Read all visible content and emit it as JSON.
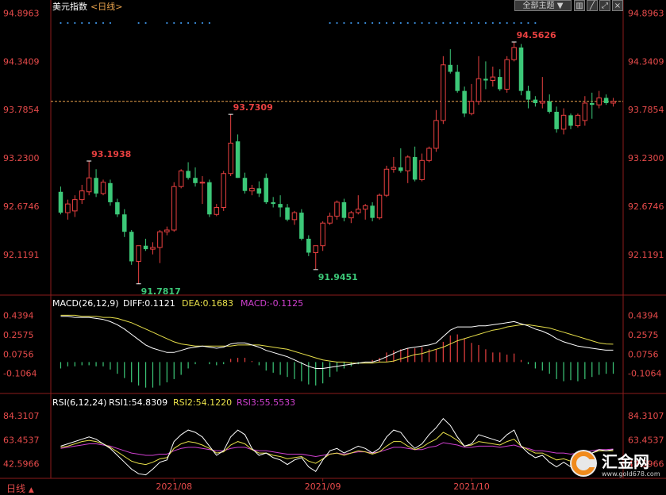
{
  "header": {
    "title": "美元指数",
    "period_link": "<日线>",
    "theme_selector": "全部主题",
    "theme_arrow": "▼"
  },
  "footer": {
    "period_label": "日线",
    "period_arrow": "▲"
  },
  "watermark": {
    "name": "汇金网",
    "url": "www.gold678.com"
  },
  "colors": {
    "background": "#000000",
    "up": "#e84040",
    "down": "#3cc878",
    "axis_text": "#e84b4b",
    "grid": "#8b1c1c",
    "price_line": "#e8a24c",
    "diff_line": "#ffffff",
    "dea_line": "#e8e04a",
    "rsi1": "#ffffff",
    "rsi2": "#e8e04a",
    "rsi3": "#d040d0"
  },
  "chart_data": [
    {
      "type": "candlestick",
      "name": "price",
      "ylim": [
        91.67,
        94.9
      ],
      "y_ticks": [
        "94.8963",
        "94.3409",
        "93.7854",
        "93.2300",
        "92.6746",
        "92.1191"
      ],
      "current_price": 93.88,
      "annotations": [
        {
          "text": "93.1938",
          "index": 4,
          "value": 93.1938,
          "color": "#e84040"
        },
        {
          "text": "91.7817",
          "index": 11,
          "value": 91.7817,
          "color": "#3cc878"
        },
        {
          "text": "93.7309",
          "index": 24,
          "value": 93.7309,
          "color": "#e84040"
        },
        {
          "text": "91.9451",
          "index": 36,
          "value": 91.9451,
          "color": "#3cc878"
        },
        {
          "text": "94.5626",
          "index": 64,
          "value": 94.5626,
          "color": "#e84040"
        }
      ],
      "x_labels": [
        {
          "text": "2021/08",
          "index": 16
        },
        {
          "text": "2021/09",
          "index": 37
        },
        {
          "text": "2021/10",
          "index": 58
        }
      ],
      "candles": [
        {
          "o": 92.84,
          "h": 92.9,
          "l": 92.58,
          "c": 92.6
        },
        {
          "o": 92.6,
          "h": 92.75,
          "l": 92.52,
          "c": 92.7
        },
        {
          "o": 92.62,
          "h": 92.8,
          "l": 92.55,
          "c": 92.75
        },
        {
          "o": 92.75,
          "h": 92.92,
          "l": 92.7,
          "c": 92.85
        },
        {
          "o": 92.84,
          "h": 93.19,
          "l": 92.8,
          "c": 93.0
        },
        {
          "o": 93.0,
          "h": 93.1,
          "l": 92.78,
          "c": 92.82
        },
        {
          "o": 92.82,
          "h": 92.98,
          "l": 92.8,
          "c": 92.95
        },
        {
          "o": 92.94,
          "h": 92.98,
          "l": 92.68,
          "c": 92.72
        },
        {
          "o": 92.72,
          "h": 92.76,
          "l": 92.55,
          "c": 92.58
        },
        {
          "o": 92.58,
          "h": 92.64,
          "l": 92.32,
          "c": 92.38
        },
        {
          "o": 92.38,
          "h": 92.4,
          "l": 92.0,
          "c": 92.04
        },
        {
          "o": 92.04,
          "h": 92.2,
          "l": 91.78,
          "c": 92.22
        },
        {
          "o": 92.22,
          "h": 92.3,
          "l": 92.16,
          "c": 92.18
        },
        {
          "o": 92.18,
          "h": 92.26,
          "l": 92.12,
          "c": 92.2
        },
        {
          "o": 92.2,
          "h": 92.4,
          "l": 92.02,
          "c": 92.38
        },
        {
          "o": 92.38,
          "h": 92.44,
          "l": 92.34,
          "c": 92.4
        },
        {
          "o": 92.4,
          "h": 92.95,
          "l": 92.38,
          "c": 92.9
        },
        {
          "o": 92.9,
          "h": 93.1,
          "l": 92.88,
          "c": 93.08
        },
        {
          "o": 93.08,
          "h": 93.18,
          "l": 92.98,
          "c": 93.0
        },
        {
          "o": 93.0,
          "h": 93.12,
          "l": 92.9,
          "c": 92.94
        },
        {
          "o": 92.94,
          "h": 93.02,
          "l": 92.7,
          "c": 92.95
        },
        {
          "o": 92.95,
          "h": 92.98,
          "l": 92.55,
          "c": 92.58
        },
        {
          "o": 92.58,
          "h": 92.7,
          "l": 92.56,
          "c": 92.66
        },
        {
          "o": 92.66,
          "h": 93.08,
          "l": 92.62,
          "c": 93.05
        },
        {
          "o": 93.05,
          "h": 93.73,
          "l": 93.02,
          "c": 93.4
        },
        {
          "o": 93.42,
          "h": 93.5,
          "l": 93.0,
          "c": 93.0
        },
        {
          "o": 93.0,
          "h": 93.06,
          "l": 92.82,
          "c": 92.85
        },
        {
          "o": 92.85,
          "h": 92.92,
          "l": 92.8,
          "c": 92.88
        },
        {
          "o": 92.88,
          "h": 92.96,
          "l": 92.78,
          "c": 92.82
        },
        {
          "o": 93.0,
          "h": 93.05,
          "l": 92.7,
          "c": 92.72
        },
        {
          "o": 92.72,
          "h": 92.78,
          "l": 92.66,
          "c": 92.7
        },
        {
          "o": 92.7,
          "h": 92.8,
          "l": 92.55,
          "c": 92.66
        },
        {
          "o": 92.66,
          "h": 92.7,
          "l": 92.5,
          "c": 92.52
        },
        {
          "o": 92.52,
          "h": 92.62,
          "l": 92.46,
          "c": 92.6
        },
        {
          "o": 92.6,
          "h": 92.64,
          "l": 92.28,
          "c": 92.3
        },
        {
          "o": 92.3,
          "h": 92.34,
          "l": 92.1,
          "c": 92.14
        },
        {
          "o": 92.14,
          "h": 92.2,
          "l": 91.95,
          "c": 92.22
        },
        {
          "o": 92.22,
          "h": 92.5,
          "l": 92.16,
          "c": 92.48
        },
        {
          "o": 92.48,
          "h": 92.6,
          "l": 92.46,
          "c": 92.56
        },
        {
          "o": 92.56,
          "h": 92.74,
          "l": 92.52,
          "c": 92.72
        },
        {
          "o": 92.72,
          "h": 92.76,
          "l": 92.5,
          "c": 92.54
        },
        {
          "o": 92.54,
          "h": 92.62,
          "l": 92.48,
          "c": 92.6
        },
        {
          "o": 92.6,
          "h": 92.8,
          "l": 92.58,
          "c": 92.64
        },
        {
          "o": 92.64,
          "h": 92.7,
          "l": 92.52,
          "c": 92.68
        },
        {
          "o": 92.68,
          "h": 92.72,
          "l": 92.5,
          "c": 92.54
        },
        {
          "o": 92.54,
          "h": 92.82,
          "l": 92.52,
          "c": 92.8
        },
        {
          "o": 92.8,
          "h": 93.14,
          "l": 92.78,
          "c": 93.1
        },
        {
          "o": 93.1,
          "h": 93.24,
          "l": 93.06,
          "c": 93.12
        },
        {
          "o": 93.12,
          "h": 93.34,
          "l": 93.06,
          "c": 93.08
        },
        {
          "o": 93.08,
          "h": 93.26,
          "l": 92.94,
          "c": 93.24
        },
        {
          "o": 93.24,
          "h": 93.36,
          "l": 92.96,
          "c": 92.98
        },
        {
          "o": 92.98,
          "h": 93.28,
          "l": 92.96,
          "c": 93.2
        },
        {
          "o": 93.2,
          "h": 93.36,
          "l": 93.18,
          "c": 93.34
        },
        {
          "o": 93.34,
          "h": 93.78,
          "l": 93.3,
          "c": 93.66
        },
        {
          "o": 93.66,
          "h": 94.4,
          "l": 93.62,
          "c": 94.3
        },
        {
          "o": 94.3,
          "h": 94.48,
          "l": 94.2,
          "c": 94.22
        },
        {
          "o": 94.22,
          "h": 94.3,
          "l": 93.98,
          "c": 94.0
        },
        {
          "o": 94.0,
          "h": 94.05,
          "l": 93.7,
          "c": 93.74
        },
        {
          "o": 93.74,
          "h": 94.08,
          "l": 93.72,
          "c": 93.88
        },
        {
          "o": 93.88,
          "h": 94.4,
          "l": 93.84,
          "c": 94.14
        },
        {
          "o": 94.14,
          "h": 94.34,
          "l": 94.02,
          "c": 94.12
        },
        {
          "o": 94.12,
          "h": 94.28,
          "l": 94.05,
          "c": 94.16
        },
        {
          "o": 94.16,
          "h": 94.25,
          "l": 94.0,
          "c": 94.02
        },
        {
          "o": 94.02,
          "h": 94.4,
          "l": 93.98,
          "c": 94.36
        },
        {
          "o": 94.36,
          "h": 94.56,
          "l": 94.34,
          "c": 94.5
        },
        {
          "o": 94.5,
          "h": 94.54,
          "l": 93.95,
          "c": 94.0
        },
        {
          "o": 94.0,
          "h": 94.06,
          "l": 93.8,
          "c": 93.9
        },
        {
          "o": 93.9,
          "h": 93.94,
          "l": 93.82,
          "c": 93.86
        },
        {
          "o": 93.86,
          "h": 94.16,
          "l": 93.8,
          "c": 93.88
        },
        {
          "o": 93.88,
          "h": 93.96,
          "l": 93.74,
          "c": 93.76
        },
        {
          "o": 93.76,
          "h": 93.82,
          "l": 93.52,
          "c": 93.56
        },
        {
          "o": 93.56,
          "h": 93.8,
          "l": 93.5,
          "c": 93.72
        },
        {
          "o": 93.72,
          "h": 93.74,
          "l": 93.56,
          "c": 93.6
        },
        {
          "o": 93.6,
          "h": 93.74,
          "l": 93.58,
          "c": 93.72
        },
        {
          "o": 93.66,
          "h": 93.94,
          "l": 93.6,
          "c": 93.86
        },
        {
          "o": 93.86,
          "h": 93.98,
          "l": 93.68,
          "c": 93.84
        },
        {
          "o": 93.84,
          "h": 94.0,
          "l": 93.8,
          "c": 93.92
        },
        {
          "o": 93.92,
          "h": 93.96,
          "l": 93.84,
          "c": 93.86
        },
        {
          "o": 93.86,
          "h": 93.92,
          "l": 93.82,
          "c": 93.88
        }
      ]
    },
    {
      "type": "bar+line",
      "name": "macd",
      "label": "MACD(26,12,9)",
      "diff_text": "DIFF:0.1121",
      "dea_text": "DEA:0.1683",
      "macd_text": "MACD:-0.1125",
      "ylim": [
        -0.28,
        0.48
      ],
      "y_ticks": [
        "0.4394",
        "0.2575",
        "0.0756",
        "-0.1064"
      ],
      "diff": [
        0.43,
        0.43,
        0.42,
        0.42,
        0.42,
        0.41,
        0.4,
        0.38,
        0.35,
        0.31,
        0.26,
        0.21,
        0.16,
        0.13,
        0.11,
        0.09,
        0.09,
        0.11,
        0.13,
        0.14,
        0.15,
        0.14,
        0.13,
        0.14,
        0.17,
        0.18,
        0.18,
        0.16,
        0.14,
        0.11,
        0.09,
        0.07,
        0.05,
        0.02,
        -0.01,
        -0.04,
        -0.06,
        -0.06,
        -0.05,
        -0.04,
        -0.03,
        -0.02,
        -0.01,
        0.0,
        0.0,
        0.02,
        0.05,
        0.08,
        0.11,
        0.13,
        0.14,
        0.15,
        0.16,
        0.18,
        0.24,
        0.3,
        0.33,
        0.33,
        0.33,
        0.34,
        0.34,
        0.35,
        0.36,
        0.37,
        0.38,
        0.36,
        0.34,
        0.31,
        0.29,
        0.26,
        0.22,
        0.19,
        0.17,
        0.15,
        0.14,
        0.13,
        0.12,
        0.112,
        0.112
      ],
      "dea": [
        0.44,
        0.44,
        0.44,
        0.43,
        0.43,
        0.43,
        0.42,
        0.42,
        0.41,
        0.39,
        0.37,
        0.34,
        0.31,
        0.28,
        0.25,
        0.22,
        0.19,
        0.17,
        0.16,
        0.15,
        0.15,
        0.15,
        0.15,
        0.15,
        0.15,
        0.16,
        0.16,
        0.16,
        0.16,
        0.15,
        0.14,
        0.13,
        0.12,
        0.1,
        0.08,
        0.06,
        0.04,
        0.02,
        0.01,
        0.0,
        0.0,
        -0.01,
        -0.01,
        -0.01,
        -0.01,
        0.0,
        0.0,
        0.01,
        0.03,
        0.05,
        0.07,
        0.08,
        0.1,
        0.12,
        0.14,
        0.17,
        0.2,
        0.22,
        0.24,
        0.26,
        0.28,
        0.3,
        0.31,
        0.33,
        0.34,
        0.35,
        0.35,
        0.34,
        0.33,
        0.32,
        0.3,
        0.28,
        0.26,
        0.24,
        0.22,
        0.2,
        0.18,
        0.17,
        0.168
      ],
      "hist": [
        -0.06,
        -0.04,
        -0.04,
        -0.03,
        -0.03,
        -0.04,
        -0.04,
        -0.07,
        -0.11,
        -0.15,
        -0.19,
        -0.22,
        -0.24,
        -0.24,
        -0.22,
        -0.19,
        -0.16,
        -0.12,
        -0.06,
        -0.02,
        0.0,
        -0.02,
        -0.03,
        -0.02,
        0.03,
        0.04,
        0.04,
        0.01,
        -0.03,
        -0.08,
        -0.1,
        -0.12,
        -0.14,
        -0.16,
        -0.18,
        -0.21,
        -0.22,
        -0.2,
        -0.14,
        -0.09,
        -0.06,
        -0.04,
        -0.02,
        0.0,
        0.02,
        0.04,
        0.09,
        0.11,
        0.12,
        0.13,
        0.13,
        0.14,
        0.12,
        0.12,
        0.19,
        0.25,
        0.26,
        0.22,
        0.18,
        0.16,
        0.12,
        0.09,
        0.09,
        0.07,
        0.08,
        0.02,
        -0.02,
        -0.06,
        -0.08,
        -0.11,
        -0.16,
        -0.18,
        -0.17,
        -0.18,
        -0.16,
        -0.14,
        -0.12,
        -0.11,
        -0.11
      ]
    },
    {
      "type": "line",
      "name": "rsi",
      "label": "RSI(6,12,24)",
      "rsi1_text": "RSI1:54.8309",
      "rsi2_text": "RSI2:54.1220",
      "rsi3_text": "RSI3:55.5533",
      "ylim": [
        30,
        90
      ],
      "y_ticks": [
        "84.3107",
        "63.4537",
        "42.5966"
      ],
      "rsi1": [
        58,
        60,
        62,
        64,
        66,
        64,
        60,
        56,
        50,
        44,
        38,
        34,
        33,
        38,
        44,
        46,
        62,
        68,
        72,
        70,
        66,
        58,
        50,
        54,
        66,
        72,
        68,
        56,
        50,
        52,
        48,
        46,
        42,
        46,
        48,
        40,
        36,
        46,
        54,
        56,
        52,
        55,
        58,
        56,
        52,
        56,
        66,
        72,
        70,
        62,
        56,
        60,
        68,
        74,
        82,
        76,
        66,
        58,
        60,
        68,
        66,
        64,
        62,
        68,
        72,
        58,
        52,
        48,
        50,
        44,
        40,
        44,
        40,
        46,
        54,
        52,
        55,
        54,
        55
      ],
      "rsi2": [
        57,
        58,
        60,
        62,
        63,
        62,
        60,
        57,
        53,
        49,
        45,
        43,
        42,
        44,
        47,
        48,
        56,
        60,
        62,
        61,
        59,
        56,
        52,
        53,
        59,
        62,
        60,
        55,
        52,
        52,
        50,
        49,
        47,
        48,
        49,
        45,
        43,
        47,
        51,
        52,
        50,
        52,
        54,
        53,
        51,
        53,
        58,
        62,
        62,
        58,
        55,
        57,
        61,
        64,
        70,
        67,
        63,
        58,
        59,
        62,
        61,
        60,
        59,
        62,
        64,
        58,
        55,
        52,
        52,
        49,
        46,
        47,
        45,
        48,
        52,
        52,
        54,
        54,
        54
      ],
      "rsi3": [
        56,
        57,
        58,
        59,
        60,
        60,
        59,
        58,
        56,
        54,
        52,
        51,
        50,
        50,
        51,
        51,
        54,
        56,
        57,
        57,
        56,
        55,
        54,
        54,
        56,
        57,
        57,
        55,
        54,
        54,
        53,
        52,
        51,
        51,
        51,
        50,
        49,
        50,
        51,
        52,
        51,
        52,
        53,
        53,
        52,
        53,
        55,
        57,
        57,
        56,
        55,
        55,
        57,
        58,
        61,
        60,
        59,
        57,
        57,
        58,
        58,
        58,
        57,
        58,
        59,
        57,
        56,
        54,
        54,
        53,
        52,
        52,
        51,
        52,
        53,
        54,
        55,
        55,
        55.5
      ]
    }
  ]
}
